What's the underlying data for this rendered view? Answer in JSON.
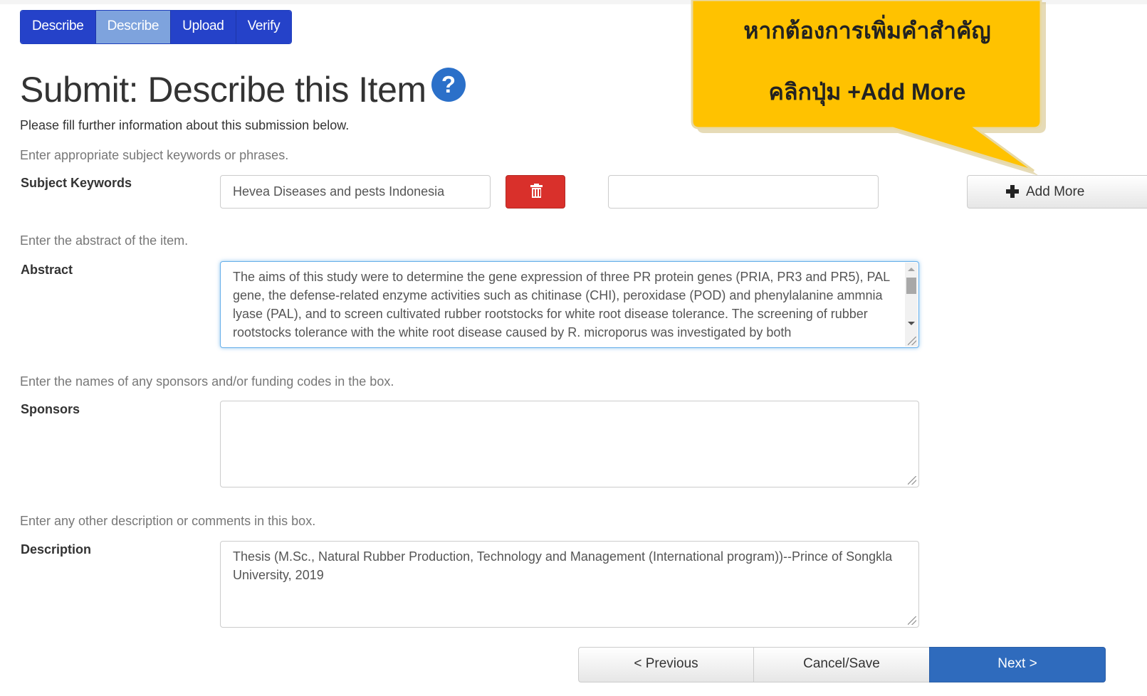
{
  "progress": {
    "steps": [
      {
        "label": "Describe"
      },
      {
        "label": "Describe",
        "current": true
      },
      {
        "label": "Upload"
      },
      {
        "label": "Verify"
      }
    ]
  },
  "page": {
    "title": "Submit: Describe this Item",
    "help_icon": "question-circle-icon",
    "intro": "Please fill further information about this submission below."
  },
  "callout": {
    "line1": "หากต้องการเพิ่มคำสำคัญ",
    "line2": "คลิกปุ่ม +Add More",
    "fill": "#ffc200"
  },
  "keywords": {
    "hint": "Enter appropriate subject keywords or phrases.",
    "label": "Subject Keywords",
    "value": "Hevea Diseases and pests Indonesia",
    "new_value": "",
    "delete_icon": "trash-icon",
    "add_more_icon": "plus-icon",
    "add_more_label": "Add More"
  },
  "abstract": {
    "hint": "Enter the abstract of the item.",
    "label": "Abstract",
    "value": "The aims of this study were to determine the gene expression of three PR protein genes (PRIA, PR3 and PR5), PAL gene, the defense-related enzyme activities such as chitinase (CHI), peroxidase (POD) and phenylalanine ammnia lyase (PAL), and to screen cultivated rubber rootstocks for white root disease tolerance. The screening of rubber rootstocks tolerance with the white root disease caused by R. microporus was investigated by both"
  },
  "sponsors": {
    "hint": "Enter the names of any sponsors and/or funding codes in the box.",
    "label": "Sponsors",
    "value": ""
  },
  "description": {
    "hint": "Enter any other description or comments in this box.",
    "label": "Description",
    "value": "Thesis (M.Sc., Natural Rubber Production, Technology and Management (International program))--Prince of Songkla University, 2019"
  },
  "nav": {
    "previous": "< Previous",
    "cancel": "Cancel/Save",
    "next": "Next >"
  },
  "colors": {
    "step_bg": "#2542c9",
    "step_current_bg": "#7ea3dd",
    "delete_bg": "#d9302b",
    "next_bg": "#2f6bbd",
    "help_bg": "#2b70c9"
  }
}
